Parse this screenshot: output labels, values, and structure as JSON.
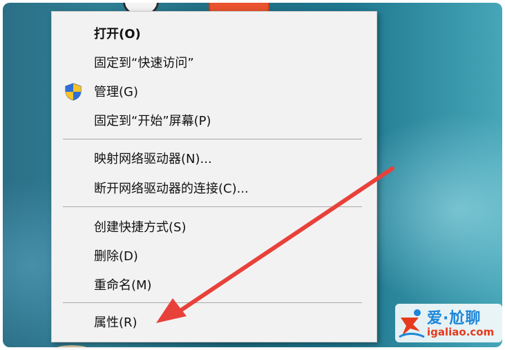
{
  "menu": {
    "items": [
      {
        "label": "打开(O)"
      },
      {
        "label": "固定到“快速访问”"
      },
      {
        "label": "管理(G)"
      },
      {
        "label": "固定到“开始”屏幕(P)"
      },
      {
        "label": "映射网络驱动器(N)..."
      },
      {
        "label": "断开网络驱动器的连接(C)..."
      },
      {
        "label": "创建快捷方式(S)"
      },
      {
        "label": "删除(D)"
      },
      {
        "label": "重命名(M)"
      },
      {
        "label": "属性(R)"
      }
    ],
    "admin_icon": "uac-shield-icon"
  },
  "annotation": {
    "icon": "red-arrow-icon",
    "color": "#e8413a"
  },
  "watermark": {
    "title": "爱·尬聊",
    "url": "igaliao.com",
    "title_color": "#1c86d8",
    "url_color": "#e63a1e"
  }
}
